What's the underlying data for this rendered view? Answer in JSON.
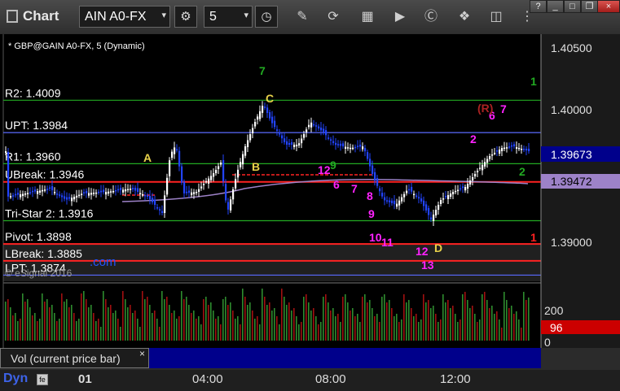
{
  "window": {
    "title": "Chart",
    "symbol": "AIN A0-FX",
    "interval": "5",
    "minimize_label": "?",
    "restore_label": "□",
    "close_label": "×"
  },
  "chart": {
    "header": "* GBP@GAIN A0-FX, 5 (Dynamic)",
    "watermark": "© eSignal 2016",
    "watermark_com": ".com",
    "price_axis": [
      "1.40500",
      "1.40000",
      "1.39000"
    ],
    "last_price": "1.39673",
    "pivot_price_badge": "1.39472",
    "volume_axis": [
      "200",
      "0"
    ],
    "volume_badge": "96",
    "levels": [
      {
        "label": "R2: 1.4009",
        "price": 1.4009,
        "color": "#22aa22"
      },
      {
        "label": "UPT: 1.3984",
        "price": 1.3984,
        "color": "#5a6aff"
      },
      {
        "label": "R1: 1.3960",
        "price": 1.396,
        "color": "#22aa22"
      },
      {
        "label": "UBreak: 1.3946",
        "price": 1.3946,
        "color": "#ff2222"
      },
      {
        "label": "Tri-Star 2: 1.3916",
        "price": 1.3916,
        "color": "#22aa22"
      },
      {
        "label": "Pivot: 1.3898",
        "price": 1.3898,
        "color": "#ff2222"
      },
      {
        "label": "LBreak: 1.3885",
        "price": 1.3885,
        "color": "#ff2222"
      },
      {
        "label": "LPT: 1.3874",
        "price": 1.3874,
        "color": "#5a6aff"
      }
    ],
    "annotations": [
      {
        "text": "A",
        "color": "#e8d24a"
      },
      {
        "text": "B",
        "color": "#e8d24a"
      },
      {
        "text": "C",
        "color": "#e8d24a"
      },
      {
        "text": "D",
        "color": "#e8d24a"
      },
      {
        "text": "7",
        "color": "#22aa22"
      },
      {
        "text": "1",
        "color": "#22aa22"
      },
      {
        "text": "2",
        "color": "#22aa22"
      },
      {
        "text": "1",
        "color": "#ff2222"
      },
      {
        "text": "12",
        "color": "#ff22ff"
      },
      {
        "text": "6",
        "color": "#ff22ff"
      },
      {
        "text": "7",
        "color": "#ff22ff"
      },
      {
        "text": "8",
        "color": "#ff22ff"
      },
      {
        "text": "9",
        "color": "#ff22ff"
      },
      {
        "text": "10",
        "color": "#ff22ff"
      },
      {
        "text": "11",
        "color": "#ff22ff"
      },
      {
        "text": "12",
        "color": "#ff22ff"
      },
      {
        "text": "13",
        "color": "#ff22ff"
      },
      {
        "text": "2",
        "color": "#ff22ff"
      },
      {
        "text": "6",
        "color": "#ff22ff"
      },
      {
        "text": "7",
        "color": "#ff22ff"
      },
      {
        "text": "(R)",
        "color": "#aa2222"
      },
      {
        "text": "9",
        "color": "#22aa22"
      }
    ]
  },
  "volume_pane": {
    "label": "Vol (current price bar)",
    "close": "×"
  },
  "time_axis": {
    "dyn": "Dyn",
    "dyn_box": "fe",
    "labels": [
      "01",
      "04:00",
      "08:00",
      "12:00"
    ]
  },
  "colors": {
    "bull_candle": "#ffffff",
    "bear_candle": "#2244ff",
    "volume_up": "#2e8b2e",
    "volume_down": "#a01010"
  }
}
